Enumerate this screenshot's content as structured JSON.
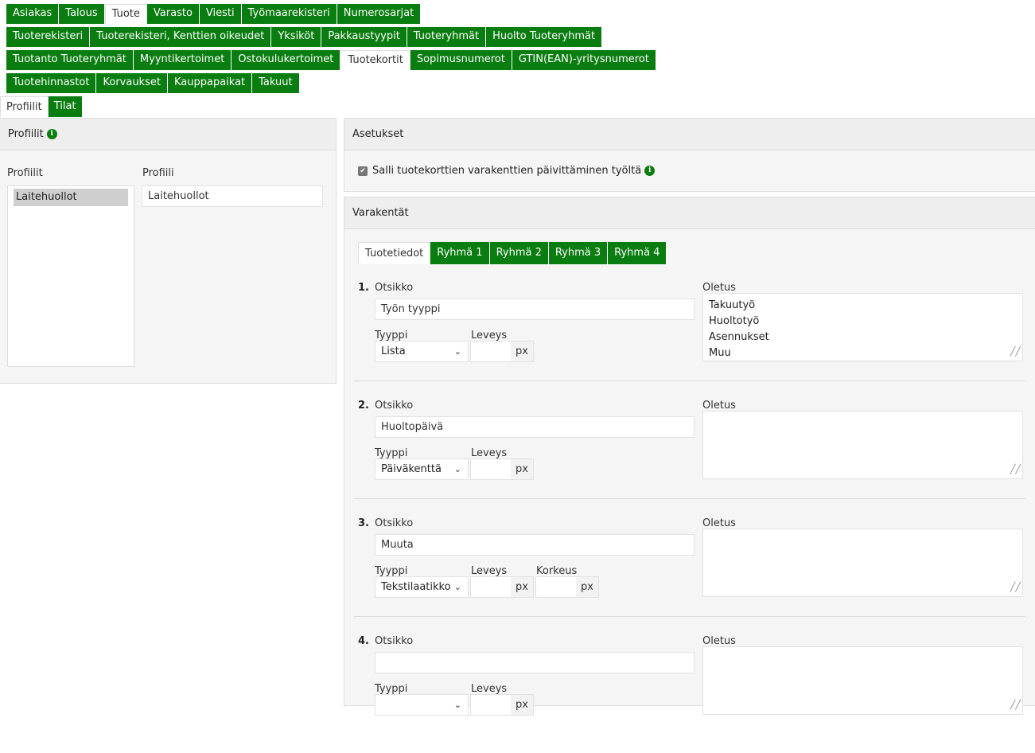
{
  "main_tabs": [
    [
      {
        "label": "Asiakas",
        "active": false
      },
      {
        "label": "Talous",
        "active": false
      },
      {
        "label": "Tuote",
        "active": true
      },
      {
        "label": "Varasto",
        "active": false
      },
      {
        "label": "Viesti",
        "active": false
      },
      {
        "label": "Työmaarekisteri",
        "active": false
      },
      {
        "label": "Numerosarjat",
        "active": false
      }
    ],
    [
      {
        "label": "Tuoterekisteri",
        "active": false
      },
      {
        "label": "Tuoterekisteri, Kenttien oikeudet",
        "active": false
      },
      {
        "label": "Yksiköt",
        "active": false
      },
      {
        "label": "Pakkaustyypit",
        "active": false
      },
      {
        "label": "Tuoteryhmät",
        "active": false
      },
      {
        "label": "Huolto Tuoteryhmät",
        "active": false
      }
    ],
    [
      {
        "label": "Tuotanto Tuoteryhmät",
        "active": false
      },
      {
        "label": "Myyntikertoimet",
        "active": false
      },
      {
        "label": "Ostokulukertoimet",
        "active": false
      },
      {
        "label": "Tuotekortit",
        "active": true
      },
      {
        "label": "Sopimusnumerot",
        "active": false
      },
      {
        "label": "GTIN(EAN)-yritysnumerot",
        "active": false
      }
    ],
    [
      {
        "label": "Tuotehinnastot",
        "active": false
      },
      {
        "label": "Korvaukset",
        "active": false
      },
      {
        "label": "Kauppapaikat",
        "active": false
      },
      {
        "label": "Takuut",
        "active": false
      }
    ]
  ],
  "sub_tabs": [
    {
      "label": "Profiilit",
      "active": true
    },
    {
      "label": "Tilat",
      "active": false
    }
  ],
  "profiles_panel": {
    "title": "Profiilit",
    "list_label": "Profiilit",
    "items": [
      "Laitehuollot"
    ],
    "name_label": "Profiili",
    "name_value": "Laitehuollot"
  },
  "settings_panel": {
    "title": "Asetukset",
    "checkbox_label": "Salli tuotekorttien varakenttien päivittäminen työltä",
    "checked": true
  },
  "extra_fields_panel": {
    "title": "Varakentät",
    "tabs": [
      {
        "label": "Tuotetiedot",
        "active": true
      },
      {
        "label": "Ryhmä 1",
        "active": false
      },
      {
        "label": "Ryhmä 2",
        "active": false
      },
      {
        "label": "Ryhmä 3",
        "active": false
      },
      {
        "label": "Ryhmä 4",
        "active": false
      }
    ],
    "labels": {
      "title": "Otsikko",
      "default": "Oletus",
      "type": "Tyyppi",
      "width": "Leveys",
      "height": "Korkeus",
      "px": "px"
    },
    "fields": [
      {
        "number": "1.",
        "title": "Työn tyyppi",
        "type": "Lista",
        "default_text": "Takuutyö\nHuoltotyö\nAsennukset\nMuu",
        "has_height": false
      },
      {
        "number": "2.",
        "title": "Huoltopäivä",
        "type": "Päiväkenttä",
        "default_text": "",
        "has_height": false
      },
      {
        "number": "3.",
        "title": "Muuta",
        "type": "Tekstilaatikko",
        "default_text": "",
        "has_height": true
      },
      {
        "number": "4.",
        "title": "",
        "type": "",
        "default_text": "",
        "has_height": false
      }
    ]
  },
  "colors": {
    "accent": "#0a7d10",
    "panel_bg": "#f5f5f5",
    "header_bg": "#eeeeee"
  }
}
